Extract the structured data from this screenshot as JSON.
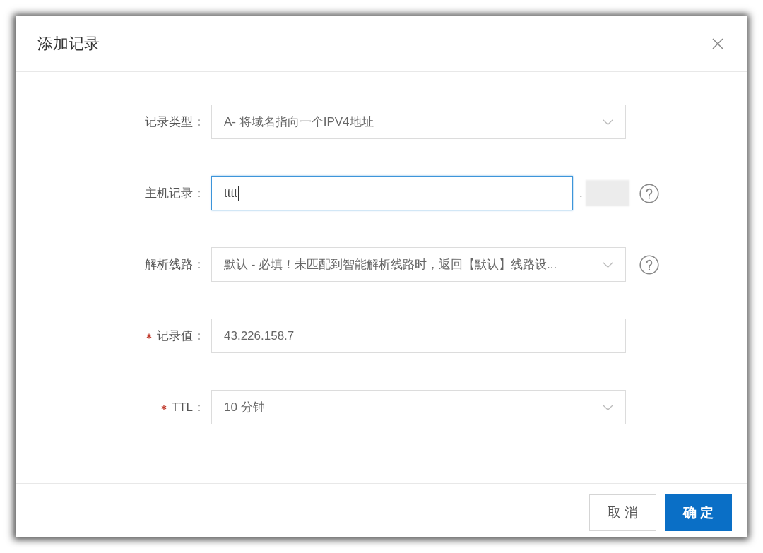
{
  "dialog": {
    "title": "添加记录"
  },
  "form": {
    "fields": [
      {
        "label": "记录类型：",
        "kind": "select",
        "value": "A- 将域名指向一个IPV4地址",
        "required": false,
        "focused": false,
        "help": false
      },
      {
        "label": "主机记录：",
        "kind": "input",
        "value": "tttt",
        "required": false,
        "focused": true,
        "help": true,
        "domain": {
          "prefix": ".",
          "redacted": true
        }
      },
      {
        "label": "解析线路：",
        "kind": "select",
        "value": "默认 - 必填！未匹配到智能解析线路时，返回【默认】线路设...",
        "required": false,
        "focused": false,
        "help": true
      },
      {
        "label": "记录值：",
        "kind": "input",
        "value": "43.226.158.7",
        "required": true,
        "focused": false,
        "help": false
      },
      {
        "label": "TTL：",
        "kind": "select",
        "value": "10 分钟",
        "required": true,
        "focused": false,
        "help": false
      }
    ]
  },
  "buttons": [
    {
      "label": "取消",
      "kind": "default"
    },
    {
      "label": "确定",
      "kind": "primary"
    }
  ]
}
